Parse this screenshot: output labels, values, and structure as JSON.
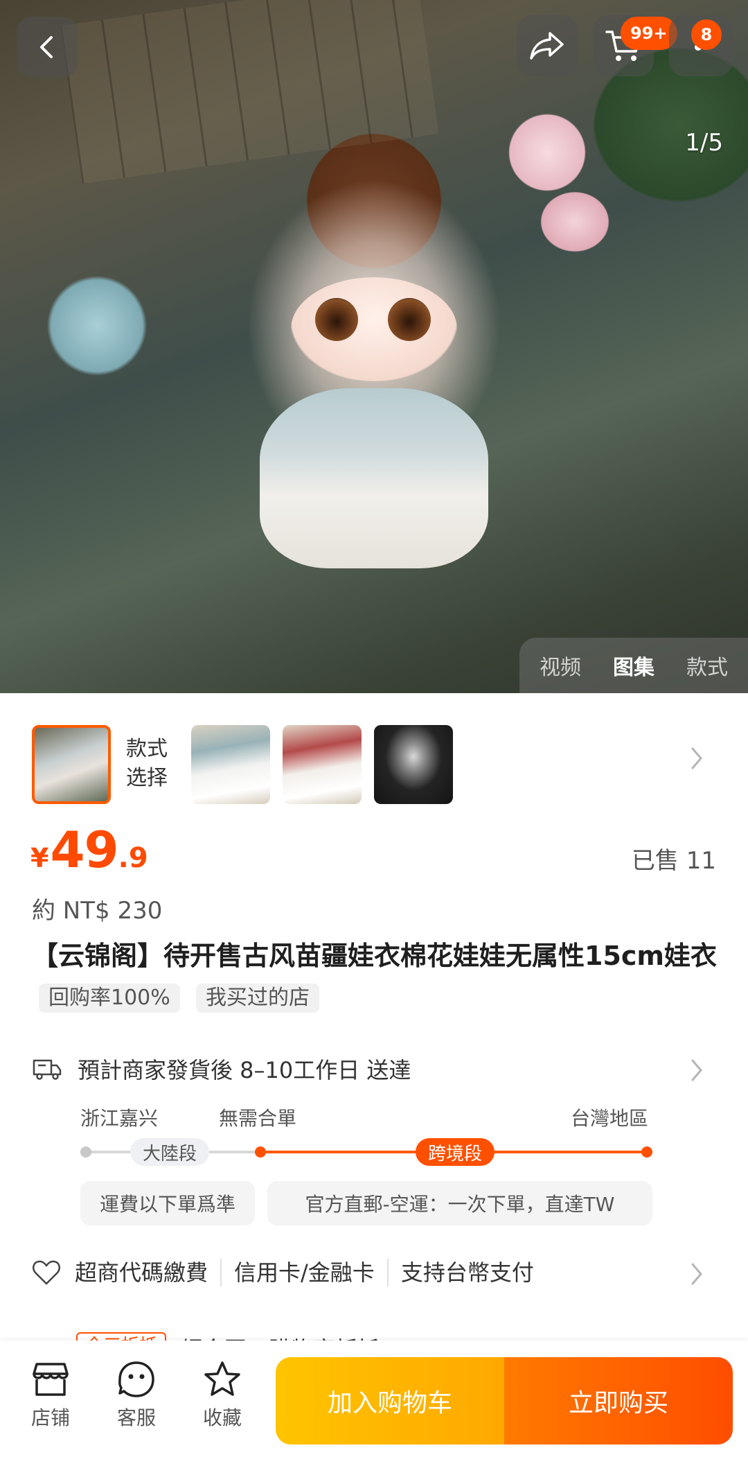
{
  "hero": {
    "pager": "1/5",
    "cart_badge": "99+",
    "msg_badge": "8",
    "media_tabs": [
      {
        "label": "视频",
        "active": false
      },
      {
        "label": "图集",
        "active": true
      },
      {
        "label": "款式",
        "active": false
      }
    ]
  },
  "variants": {
    "label_line1": "款式",
    "label_line2": "选择",
    "selected_index": 0
  },
  "price": {
    "currency": "¥",
    "integer": "49",
    "decimal": ".9",
    "sold": "已售 11",
    "converted": "約 NT$ 230"
  },
  "product": {
    "title": "【云锦阁】待开售古风苗疆娃衣棉花娃娃无属性15cm娃衣",
    "tags": [
      "回购率100%",
      "我买过的店"
    ]
  },
  "shipping": {
    "estimate": "預計商家發貨後 8–10工作日 送達",
    "origin": "浙江嘉兴",
    "consolidation": "無需合單",
    "destination": "台灣地區",
    "segment_mainland": "大陸段",
    "segment_crossborder": "跨境段",
    "note_mainland": "運費以下單爲準",
    "note_crossborder": "官方直郵-空運：一次下單，直達TW"
  },
  "payment": {
    "items": [
      "超商代碼繳費",
      "信用卡/金融卡",
      "支持台幣支付"
    ]
  },
  "partial_row": {
    "badge": "全三折抵",
    "text": "領金豆，購物享折抵"
  },
  "bottom_bar": {
    "store": "店铺",
    "service": "客服",
    "favorite": "收藏",
    "add_to_cart": "加入购物车",
    "buy_now": "立即购买"
  },
  "colors": {
    "accent": "#ff5000",
    "price": "#ff4a00",
    "cart_gradient": [
      "#ffc400",
      "#ffa800"
    ],
    "buy_gradient": [
      "#ff7a00",
      "#ff4d00"
    ]
  }
}
